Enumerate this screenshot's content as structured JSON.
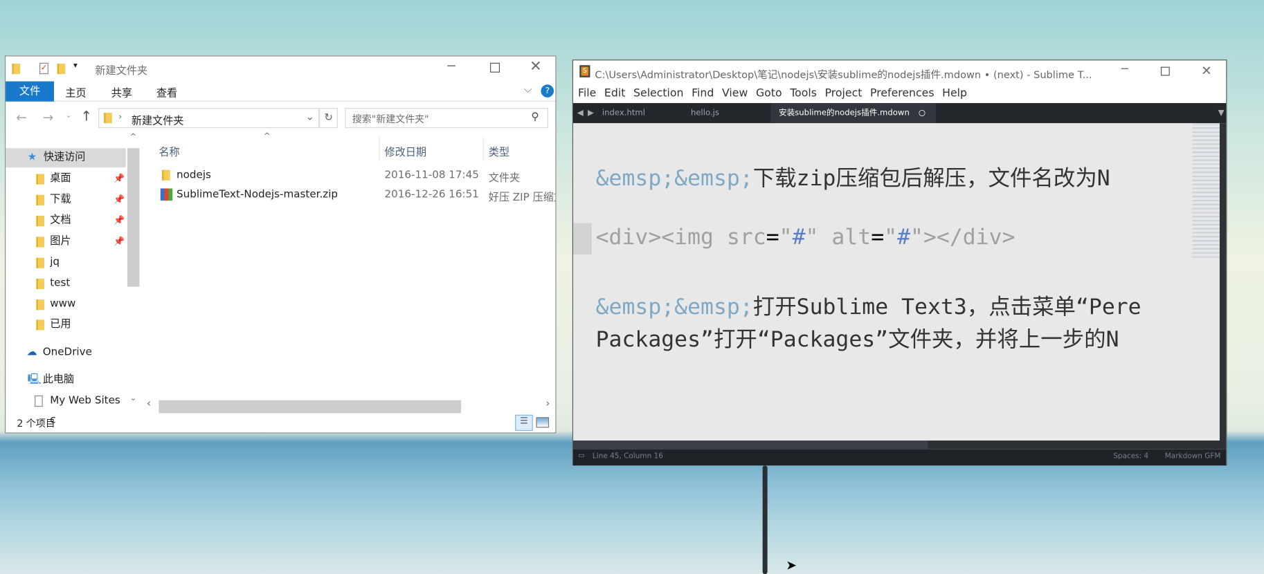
{
  "explorer": {
    "title": "新建文件夹",
    "ribbon_tabs": [
      "文件",
      "主页",
      "共享",
      "查看"
    ],
    "address": "新建文件夹",
    "search_placeholder": "搜索\"新建文件夹\"",
    "nav": {
      "quick_access": "快速访问",
      "pinned": [
        "桌面",
        "下载",
        "文档",
        "图片"
      ],
      "folders": [
        "jq",
        "test",
        "www",
        "已用"
      ],
      "onedrive": "OneDrive",
      "this_pc": "此电脑",
      "web_sites": "My Web Sites c"
    },
    "columns": [
      "名称",
      "修改日期",
      "类型"
    ],
    "files": [
      {
        "name": "nodejs",
        "date": "2016-11-08 17:45",
        "type": "文件夹"
      },
      {
        "name": "SublimeText-Nodejs-master.zip",
        "date": "2016-12-26 16:51",
        "type": "好压 ZIP 压缩文"
      }
    ],
    "status": "2 个项目"
  },
  "sublime": {
    "title": "C:\\Users\\Administrator\\Desktop\\笔记\\nodejs\\安装sublime的nodejs插件.mdown • (next) - Sublime T...",
    "menu": [
      "File",
      "Edit",
      "Selection",
      "Find",
      "View",
      "Goto",
      "Tools",
      "Project",
      "Preferences",
      "Help"
    ],
    "tabs": [
      "index.html",
      "hello.js",
      "安装sublime的nodejs插件.mdown"
    ],
    "lines": {
      "l1_ent": "&emsp;&emsp;",
      "l1_text": "下载zip压缩包后解压，文件名改为N",
      "l2_a": "<div><img src",
      "l2_eq1": "=",
      "l2_q1": "\"",
      "l2_h1": "#",
      "l2_q2": "\"",
      "l2_b": " alt",
      "l2_eq2": "=",
      "l2_q3": "\"",
      "l2_h2": "#",
      "l2_q4": "\"",
      "l2_c": "></div>",
      "l3_ent": "&emsp;&emsp;",
      "l3_text": "打开Sublime Text3，点击菜单“Pere",
      "l4_text": "Packages”打开“Packages”文件夹，并将上一步的N"
    },
    "status": {
      "position": "Line 45, Column 16",
      "spaces": "Spaces: 4",
      "syntax": "Markdown GFM"
    }
  }
}
